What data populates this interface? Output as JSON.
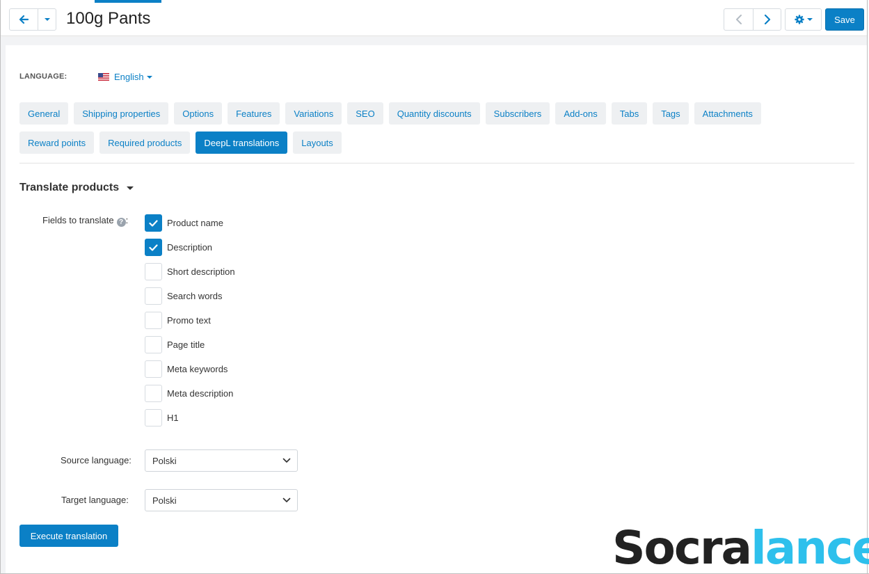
{
  "header": {
    "title": "100g Pants",
    "save_label": "Save"
  },
  "language": {
    "label": "LANGUAGE:",
    "selected": "English"
  },
  "tabs": [
    {
      "label": "General",
      "active": false
    },
    {
      "label": "Shipping properties",
      "active": false
    },
    {
      "label": "Options",
      "active": false
    },
    {
      "label": "Features",
      "active": false
    },
    {
      "label": "Variations",
      "active": false
    },
    {
      "label": "SEO",
      "active": false
    },
    {
      "label": "Quantity discounts",
      "active": false
    },
    {
      "label": "Subscribers",
      "active": false
    },
    {
      "label": "Add-ons",
      "active": false
    },
    {
      "label": "Tabs",
      "active": false
    },
    {
      "label": "Tags",
      "active": false
    },
    {
      "label": "Attachments",
      "active": false
    },
    {
      "label": "Reward points",
      "active": false
    },
    {
      "label": "Required products",
      "active": false
    },
    {
      "label": "DeepL translations",
      "active": true
    },
    {
      "label": "Layouts",
      "active": false
    }
  ],
  "section": {
    "title": "Translate products",
    "fields_label": "Fields to translate",
    "fields_colon": ":",
    "fields": [
      {
        "label": "Product name",
        "checked": true
      },
      {
        "label": "Description",
        "checked": true
      },
      {
        "label": "Short description",
        "checked": false
      },
      {
        "label": "Search words",
        "checked": false
      },
      {
        "label": "Promo text",
        "checked": false
      },
      {
        "label": "Page title",
        "checked": false
      },
      {
        "label": "Meta keywords",
        "checked": false
      },
      {
        "label": "Meta description",
        "checked": false
      },
      {
        "label": "H1",
        "checked": false
      }
    ],
    "source_label": "Source language:",
    "source_value": "Polski",
    "target_label": "Target language:",
    "target_value": "Polski",
    "execute_label": "Execute translation"
  },
  "watermark": {
    "part1": "Socra",
    "part2": "lance"
  },
  "colors": {
    "accent": "#0b80c6",
    "tab_bg": "#eef0f2",
    "watermark_blue": "#2ec0ec"
  }
}
